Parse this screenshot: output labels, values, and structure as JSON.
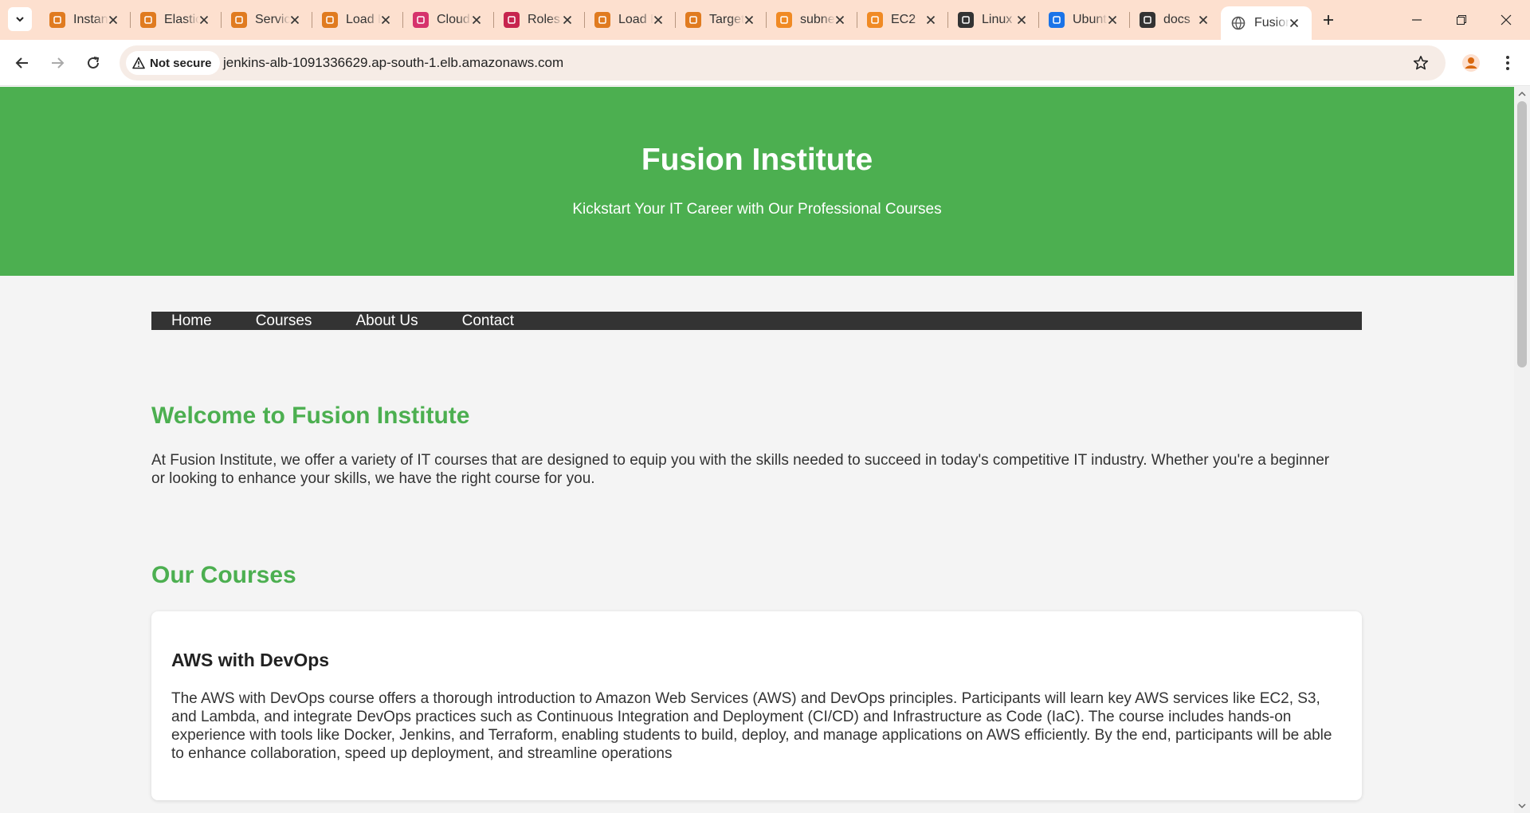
{
  "browser": {
    "tabs": [
      {
        "title": "Instances",
        "favicon": "aws-ec2-icon",
        "color": "#e07b20"
      },
      {
        "title": "Elastic IPs",
        "favicon": "aws-ec2-icon",
        "color": "#e07b20"
      },
      {
        "title": "Services",
        "favicon": "aws-ec2-icon",
        "color": "#e07b20"
      },
      {
        "title": "Load Balancers",
        "favicon": "aws-ec2-icon",
        "color": "#e07b20"
      },
      {
        "title": "CloudFront",
        "favicon": "aws-cloudfront-icon",
        "color": "#d6336c"
      },
      {
        "title": "Roles",
        "favicon": "aws-iam-icon",
        "color": "#c7254e"
      },
      {
        "title": "Load Balancers",
        "favicon": "aws-ec2-icon",
        "color": "#e07b20"
      },
      {
        "title": "Target groups",
        "favicon": "aws-ec2-icon",
        "color": "#e07b20"
      },
      {
        "title": "subnets",
        "favicon": "cube-icon",
        "color": "#f08a24"
      },
      {
        "title": "EC2",
        "favicon": "cube-icon",
        "color": "#f08a24"
      },
      {
        "title": "Linux",
        "favicon": "linux-icon",
        "color": "#333333"
      },
      {
        "title": "Ubuntu",
        "favicon": "globe-icon",
        "color": "#1a73e8"
      },
      {
        "title": "docs",
        "favicon": "github-icon",
        "color": "#333333"
      },
      {
        "title": "Fusion Institute",
        "favicon": "globe-icon",
        "color": "#555555",
        "active": true
      }
    ],
    "security_label": "Not secure",
    "url": "jenkins-alb-1091336629.ap-south-1.elb.amazonaws.com"
  },
  "page": {
    "header": {
      "title": "Fusion Institute",
      "subtitle": "Kickstart Your IT Career with Our Professional Courses",
      "bg_color": "#4caf50"
    },
    "nav": [
      "Home",
      "Courses",
      "About Us",
      "Contact"
    ],
    "welcome": {
      "heading": "Welcome to Fusion Institute",
      "text": "At Fusion Institute, we offer a variety of IT courses that are designed to equip you with the skills needed to succeed in today's competitive IT industry. Whether you're a beginner or looking to enhance your skills, we have the right course for you."
    },
    "courses": {
      "heading": "Our Courses",
      "items": [
        {
          "title": "AWS with DevOps",
          "description": "The AWS with DevOps course offers a thorough introduction to Amazon Web Services (AWS) and DevOps principles. Participants will learn key AWS services like EC2, S3, and Lambda, and integrate DevOps practices such as Continuous Integration and Deployment (CI/CD) and Infrastructure as Code (IaC). The course includes hands-on experience with tools like Docker, Jenkins, and Terraform, enabling students to build, deploy, and manage applications on AWS efficiently. By the end, participants will be able to enhance collaboration, speed up deployment, and streamline operations"
        }
      ]
    }
  }
}
